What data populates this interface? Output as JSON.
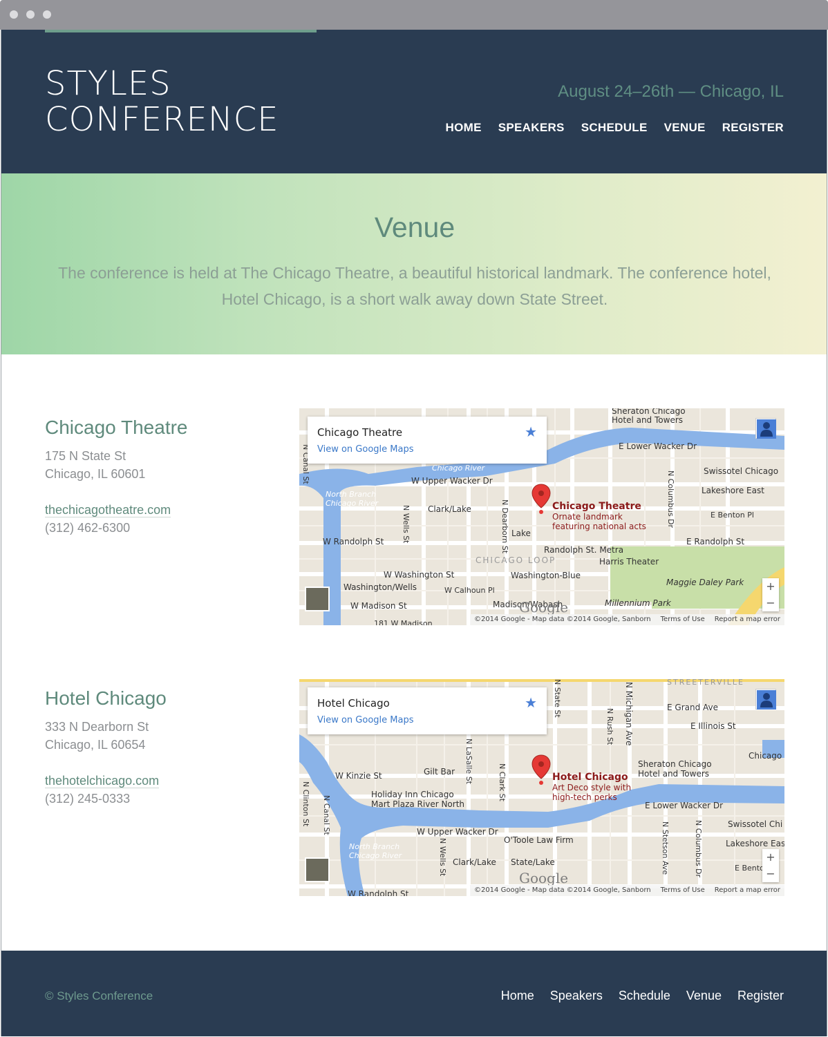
{
  "site": {
    "logo_line1": "STYLES",
    "logo_line2": "CONFERENCE",
    "tagline": "August 24–26th — Chicago, IL",
    "nav": [
      "HOME",
      "SPEAKERS",
      "SCHEDULE",
      "VENUE",
      "REGISTER"
    ]
  },
  "hero": {
    "title": "Venue",
    "text": "The conference is held at The Chicago Theatre, a beautiful historical landmark. The conference hotel, Hotel Chicago, is a short walk away down State Street."
  },
  "venues": [
    {
      "name": "Chicago Theatre",
      "address_line1": "175 N State St",
      "address_line2": "Chicago, IL 60601",
      "website": "thechicagotheatre.com",
      "phone": "(312) 462-6300",
      "map": {
        "info_title": "Chicago Theatre",
        "info_link": "View on Google Maps",
        "marker_name": "Chicago Theatre",
        "marker_desc1": "Ornate landmark",
        "marker_desc2": "featuring national acts",
        "labels": [
          "W Upper Wacker Dr",
          "E Lower Wacker Dr",
          "Chicago River",
          "North Branch Chicago River",
          "Clark/Lake",
          "Lake",
          "W Randolph St",
          "E Randolph St",
          "Randolph St. Metra",
          "Harris Theater",
          "CHICAGO LOOP",
          "W Washington St",
          "Washington-Blue",
          "Washington/Wells",
          "W Calhoun Pl",
          "W Madison St",
          "Madison/Wabash",
          "Millennium Park",
          "Maggie Daley Park",
          "Swissotel Chicago",
          "Lakeshore East",
          "E Benton Pl",
          "Sheraton Chicago Hotel and Towers",
          "N Wells St",
          "N Dearborn St",
          "N Columbus Dr",
          "N Canal St",
          "181 W Madison"
        ],
        "attribution": "©2014 Google - Map data ©2014 Google, Sanborn",
        "terms": "Terms of Use",
        "report": "Report a map error",
        "google": "Google"
      }
    },
    {
      "name": "Hotel Chicago",
      "address_line1": "333 N Dearborn St",
      "address_line2": "Chicago, IL 60654",
      "website": "thehotelchicago.com",
      "phone": "(312) 245-0333",
      "map": {
        "info_title": "Hotel Chicago",
        "info_link": "View on Google Maps",
        "marker_name": "Hotel Chicago",
        "marker_desc1": "Art Deco style with",
        "marker_desc2": "high-tech perks",
        "labels": [
          "STREETERVILLE",
          "E Grand Ave",
          "E Illinois St",
          "N Michigan Ave",
          "N Rush St",
          "N State St",
          "W Kinzie St",
          "Gilt Bar",
          "Holiday Inn Chicago Mart Plaza River North",
          "N LaSalle St",
          "N Clark St",
          "Sheraton Chicago Hotel and Towers",
          "Chicago",
          "E Lower Wacker Dr",
          "W Upper Wacker Dr",
          "O'Toole Law Firm",
          "Swissotel Chi",
          "Lakeshore Eas",
          "North Branch Chicago River",
          "Clark/Lake",
          "State/Lake",
          "N Wells St",
          "N Stetson Ave",
          "N Columbus Dr",
          "N Canal St",
          "N Clinton St",
          "E Bento",
          "W Randolph St"
        ],
        "attribution": "©2014 Google - Map data ©2014 Google, Sanborn",
        "terms": "Terms of Use",
        "report": "Report a map error",
        "google": "Google"
      }
    }
  ],
  "footer": {
    "copyright": "© Styles Conference",
    "nav": [
      "Home",
      "Speakers",
      "Schedule",
      "Venue",
      "Register"
    ]
  },
  "colors": {
    "header_bg": "#2a3c52",
    "accent": "#5f8a7c",
    "river": "#8ab3e8",
    "park": "#c8dfa8",
    "marker": "#e53935"
  }
}
